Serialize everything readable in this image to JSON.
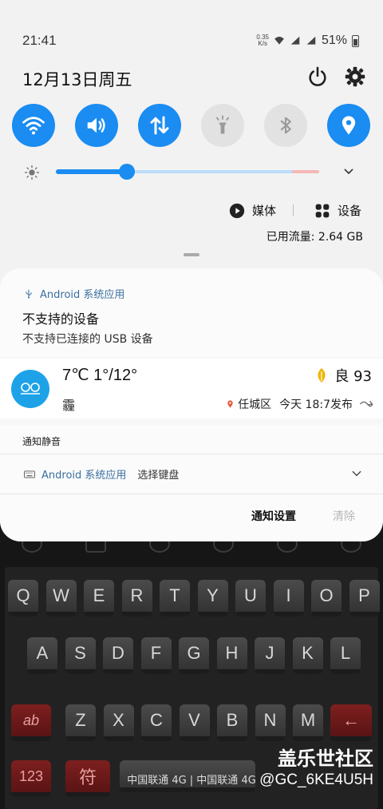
{
  "status_bar": {
    "time": "21:41",
    "net_speed_value": "0.35",
    "net_speed_unit": "K/s",
    "battery_percent": "51%"
  },
  "header": {
    "date": "12月13日周五"
  },
  "quick_toggles": [
    {
      "name": "wifi",
      "state": "on"
    },
    {
      "name": "sound",
      "state": "on"
    },
    {
      "name": "mobile-data",
      "state": "on"
    },
    {
      "name": "flashlight",
      "state": "off"
    },
    {
      "name": "bluetooth",
      "state": "off"
    },
    {
      "name": "location",
      "state": "on"
    }
  ],
  "brightness": {
    "level": 0.27
  },
  "media_output": {
    "media_label": "媒体",
    "devices_label": "设备"
  },
  "data_usage": "已用流量: 2.64 GB",
  "notifications": {
    "usb": {
      "app": "Android 系统应用",
      "title": "不支持的设备",
      "body": "不支持已连接的 USB 设备"
    },
    "weather": {
      "temp": "7℃ 1°/12°",
      "condition": "霾",
      "aqi": "良 93",
      "location": "任城区",
      "updated": "今天 18:7发布"
    },
    "silent_header": "通知静音",
    "keyboard": {
      "app": "Android 系统应用",
      "text": "选择键盘"
    },
    "settings_label": "通知设置",
    "clear_label": "清除"
  },
  "keyboard_bg": {
    "row1": [
      "Q",
      "W",
      "E",
      "R",
      "T",
      "Y",
      "U",
      "I",
      "O",
      "P"
    ],
    "row2": [
      "A",
      "S",
      "D",
      "F",
      "G",
      "H",
      "J",
      "K",
      "L"
    ],
    "row3": [
      "Z",
      "X",
      "C",
      "V",
      "B",
      "N",
      "M"
    ],
    "shift_label": "ab",
    "num_label": "123",
    "sym_label": "符",
    "carrier_text": "中国联通 4G | 中国联通 4G",
    "watermark_title": "盖乐世社区",
    "watermark_id": "@GC_6KE4U5H"
  },
  "colors": {
    "accent": "#1a8cf2",
    "toggle_off": "#e2e2e2",
    "aqi_leaf": "#f0b400",
    "location_pin": "#e8543a"
  }
}
